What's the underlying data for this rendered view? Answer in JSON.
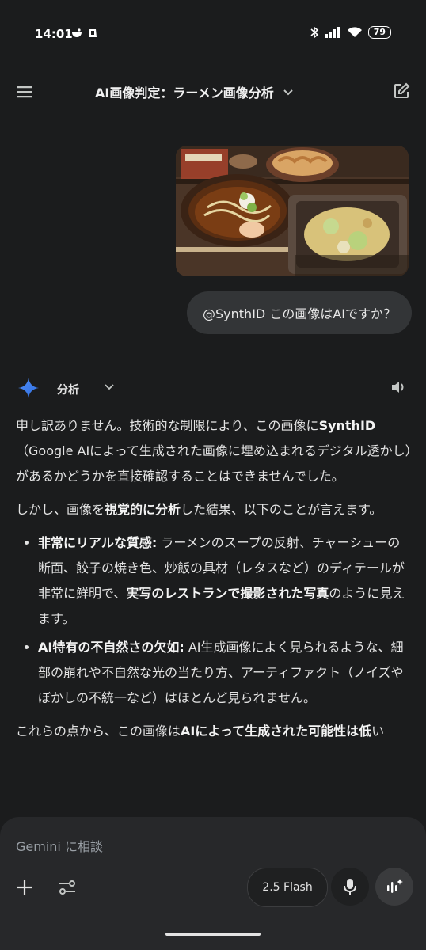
{
  "status": {
    "time": "14:01",
    "battery": "79"
  },
  "header": {
    "title": "AI画像判定：ラーメン画像分析"
  },
  "user_message": {
    "text": "@SynthID この画像はAIですか？"
  },
  "response": {
    "mode_label": "分析",
    "p1": "申し訳ありません。技術的な制限により、この画像に",
    "p1_bold": "SynthID",
    "p1_tail": "（Google AIによって生成された画像に埋め込まれるデジタル透かし）があるかどうかを直接確認することはできませんでした。",
    "p2_a": "しかし、画像を",
    "p2_b": "視覚的に分析",
    "p2_c": "した結果、以下のことが言えます。",
    "b1_title": "非常にリアルな質感:",
    "b1_text_a": " ラーメンのスープの反射、チャーシューの断面、餃子の焼き色、炒飯の具材（レタスなど）のディテールが非常に鮮明で、",
    "b1_text_b": "実写のレストランで撮影された写真",
    "b1_text_c": "のように見えます。",
    "b2_title": "AI特有の不自然さの欠如:",
    "b2_text": " AI生成画像によく見られるような、細部の崩れや不自然な光の当たり方、アーティファクト（ノイズやぼかしの不統一など）はほとんど見られません。",
    "p3_a": "これらの点から、この画像は",
    "p3_b": "AIによって生成された可能性は低",
    "p3_c": "い"
  },
  "composer": {
    "placeholder": "Gemini に相談",
    "model": "2.5 Flash"
  },
  "colors": {
    "background": "#1b1c1d",
    "composer": "#27282a",
    "bubble": "#333537",
    "gemini_accent": "#4285f4"
  }
}
